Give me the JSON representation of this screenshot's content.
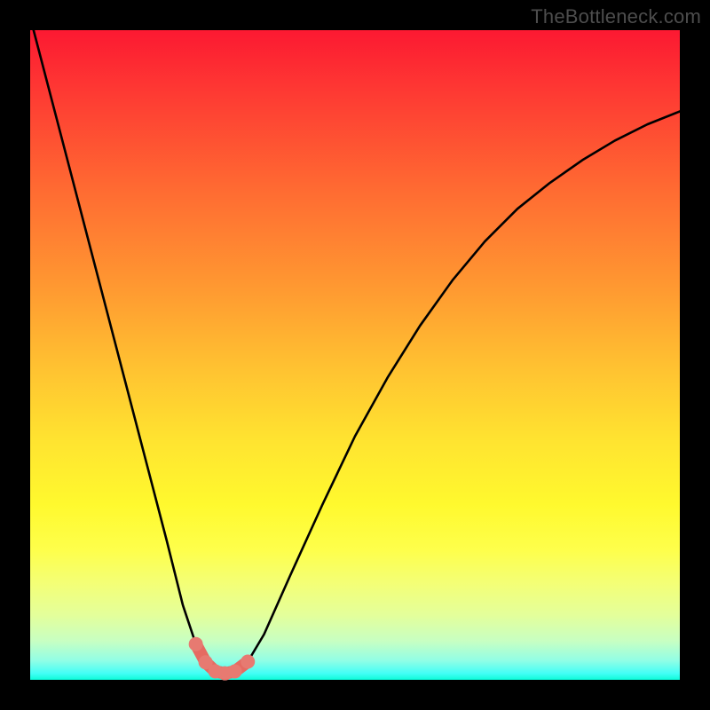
{
  "watermark": "TheBottleneck.com",
  "colors": {
    "page_bg": "#000000",
    "curve_stroke": "#000000",
    "marker_fill": "#e77a71",
    "marker_stroke": "#e56b62"
  },
  "chart_data": {
    "type": "line",
    "title": "",
    "xlabel": "",
    "ylabel": "",
    "xlim": [
      0,
      1
    ],
    "ylim": [
      0,
      1
    ],
    "grid": false,
    "legend": false,
    "series": [
      {
        "name": "curve",
        "x": [
          0.0,
          0.03,
          0.06,
          0.09,
          0.12,
          0.15,
          0.18,
          0.21,
          0.235,
          0.255,
          0.27,
          0.285,
          0.3,
          0.315,
          0.335,
          0.36,
          0.4,
          0.45,
          0.5,
          0.55,
          0.6,
          0.65,
          0.7,
          0.75,
          0.8,
          0.85,
          0.9,
          0.95,
          1.0
        ],
        "y": [
          1.02,
          0.905,
          0.79,
          0.675,
          0.56,
          0.445,
          0.33,
          0.215,
          0.115,
          0.055,
          0.027,
          0.013,
          0.01,
          0.013,
          0.028,
          0.07,
          0.16,
          0.27,
          0.375,
          0.465,
          0.545,
          0.615,
          0.675,
          0.725,
          0.765,
          0.8,
          0.83,
          0.855,
          0.875
        ]
      },
      {
        "name": "markers",
        "render": "scatter",
        "x": [
          0.255,
          0.27,
          0.285,
          0.3,
          0.315,
          0.335
        ],
        "y": [
          0.055,
          0.027,
          0.013,
          0.01,
          0.013,
          0.028
        ]
      }
    ]
  }
}
